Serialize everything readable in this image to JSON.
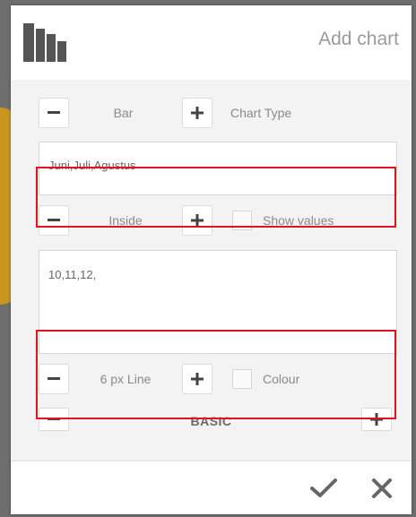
{
  "header": {
    "title": "Add chart",
    "logo_icon": "bar-chart-logo-icon"
  },
  "chart_type": {
    "value": "Bar",
    "label": "Chart Type"
  },
  "categories": {
    "value": "Juni,Juli,Agustus"
  },
  "values_position": {
    "value": "Inside",
    "label": "Show values",
    "checked": false
  },
  "data_values": {
    "value": "10,11,12,"
  },
  "line": {
    "value": "6 px Line",
    "label": "Colour",
    "checked": false
  },
  "preset": {
    "value": "BASIC"
  },
  "footer": {
    "confirm_icon": "checkmark-icon",
    "cancel_icon": "close-icon"
  },
  "colors": {
    "accent_highlight": "#e0141e",
    "background": "#6e6e6e",
    "panel": "#f3f3f3",
    "side_accent": "#c8951e"
  }
}
